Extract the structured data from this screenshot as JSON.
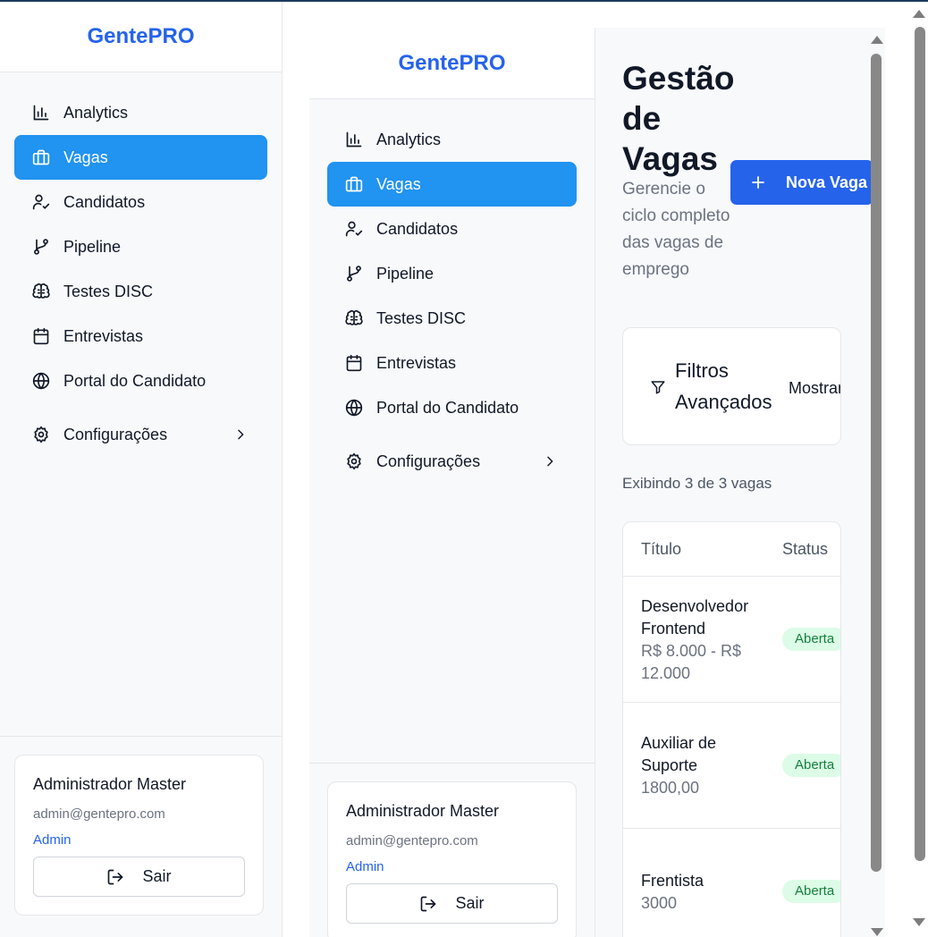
{
  "outer": {
    "brand": "GentePRO",
    "nav": [
      {
        "label": "Analytics",
        "icon": "bar-chart-icon"
      },
      {
        "label": "Vagas",
        "icon": "briefcase-icon",
        "active": true
      },
      {
        "label": "Candidatos",
        "icon": "user-check-icon"
      },
      {
        "label": "Pipeline",
        "icon": "git-branch-icon"
      },
      {
        "label": "Testes DISC",
        "icon": "brain-icon"
      },
      {
        "label": "Entrevistas",
        "icon": "calendar-icon"
      },
      {
        "label": "Portal do Candidato",
        "icon": "globe-icon"
      }
    ],
    "settings": {
      "label": "Configurações",
      "icon": "gear-icon"
    },
    "user": {
      "name": "Administrador Master",
      "email": "admin@gentepro.com",
      "role": "Admin",
      "logout": "Sair"
    }
  },
  "inner": {
    "brand": "GentePRO",
    "nav": [
      {
        "label": "Analytics",
        "icon": "bar-chart-icon"
      },
      {
        "label": "Vagas",
        "icon": "briefcase-icon",
        "active": true
      },
      {
        "label": "Candidatos",
        "icon": "user-check-icon"
      },
      {
        "label": "Pipeline",
        "icon": "git-branch-icon"
      },
      {
        "label": "Testes DISC",
        "icon": "brain-icon"
      },
      {
        "label": "Entrevistas",
        "icon": "calendar-icon"
      },
      {
        "label": "Portal do Candidato",
        "icon": "globe-icon"
      }
    ],
    "settings": {
      "label": "Configurações",
      "icon": "gear-icon"
    },
    "user": {
      "name": "Administrador Master",
      "email": "admin@gentepro.com",
      "role": "Admin",
      "logout": "Sair"
    }
  },
  "main": {
    "title": "Gestão de Vagas",
    "subtitle": "Gerencie o ciclo completo das vagas de emprego",
    "new_button": "Nova Vaga",
    "filters": {
      "title": "Filtros Avançados",
      "toggle": "Mostrar Filtros"
    },
    "count": "Exibindo 3 de 3 vagas",
    "table": {
      "headers": [
        "Título",
        "Status"
      ],
      "rows": [
        {
          "title": "Desenvolvedor Frontend",
          "salary": "R$ 8.000 - R$ 12.000",
          "status": "Aberta"
        },
        {
          "title": "Auxiliar de Suporte",
          "salary": "1800,00",
          "status": "Aberta"
        },
        {
          "title": "Frentista",
          "salary": "3000",
          "status": "Aberta"
        }
      ]
    }
  },
  "colors": {
    "brand": "#2563eb",
    "active_nav": "#2193f0",
    "badge_bg": "#dcfce7",
    "badge_text": "#15803d"
  }
}
